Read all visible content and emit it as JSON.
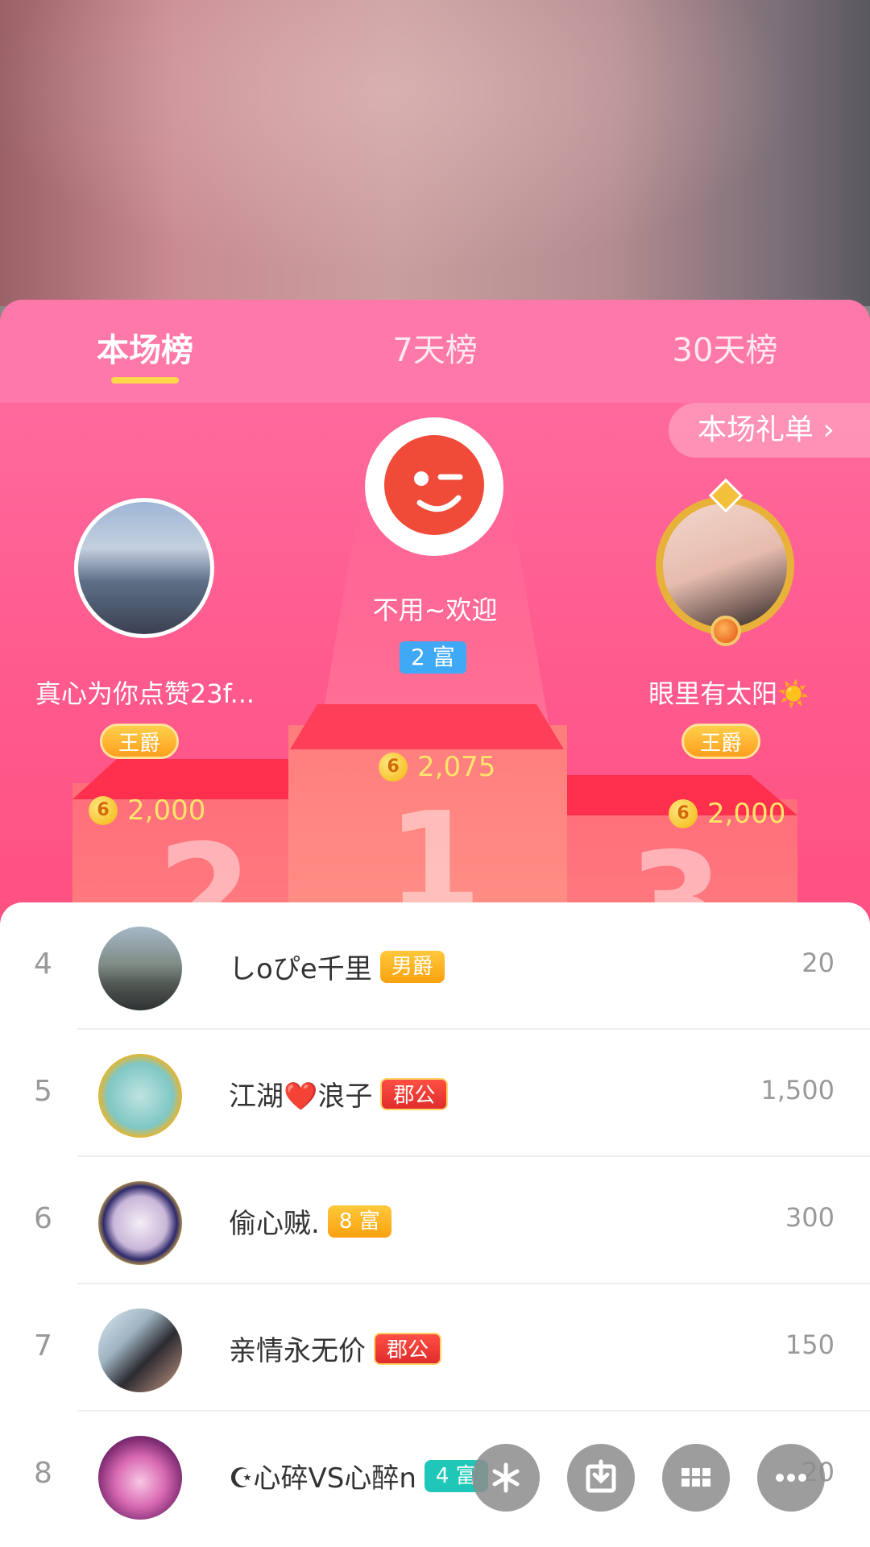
{
  "tabs": [
    {
      "label": "本场榜"
    },
    {
      "label": "7天榜"
    },
    {
      "label": "30天榜"
    }
  ],
  "gift_list_button": "本场礼单 ›",
  "top3": {
    "first": {
      "name": "不用~欢迎",
      "wealth_badge": "2 富",
      "coins": "2,075",
      "podium_number": "1"
    },
    "second": {
      "name": "真心为你点赞23f...",
      "title_badge": "王爵",
      "coins": "2,000",
      "podium_number": "2"
    },
    "third": {
      "name": "眼里有太阳☀️",
      "title_badge": "王爵",
      "coins": "2,000",
      "podium_number": "3"
    }
  },
  "coin_symbol": "6",
  "list": [
    {
      "rank": "4",
      "name": "しoぴe千里",
      "badge": "男爵",
      "badge_style": "gold",
      "value": "20"
    },
    {
      "rank": "5",
      "name": "江湖❤️浪子",
      "badge": "郡公",
      "badge_style": "red",
      "value": "1,500"
    },
    {
      "rank": "6",
      "name": "偷心贼.",
      "badge": "8 富",
      "badge_style": "gold",
      "value": "300"
    },
    {
      "rank": "7",
      "name": "亲情永无价",
      "badge": "郡公",
      "badge_style": "red",
      "value": "150"
    },
    {
      "rank": "8",
      "name": "☪心碎VS心醉n",
      "badge": "4 富",
      "badge_style": "teal",
      "value": "20"
    }
  ],
  "action_icons": [
    "sparkle-icon",
    "download-icon",
    "grid-icon",
    "more-icon"
  ],
  "colors": {
    "accent_pink": "#ff5a8e",
    "gold": "#ffd74a",
    "coin": "#ffe36a"
  }
}
